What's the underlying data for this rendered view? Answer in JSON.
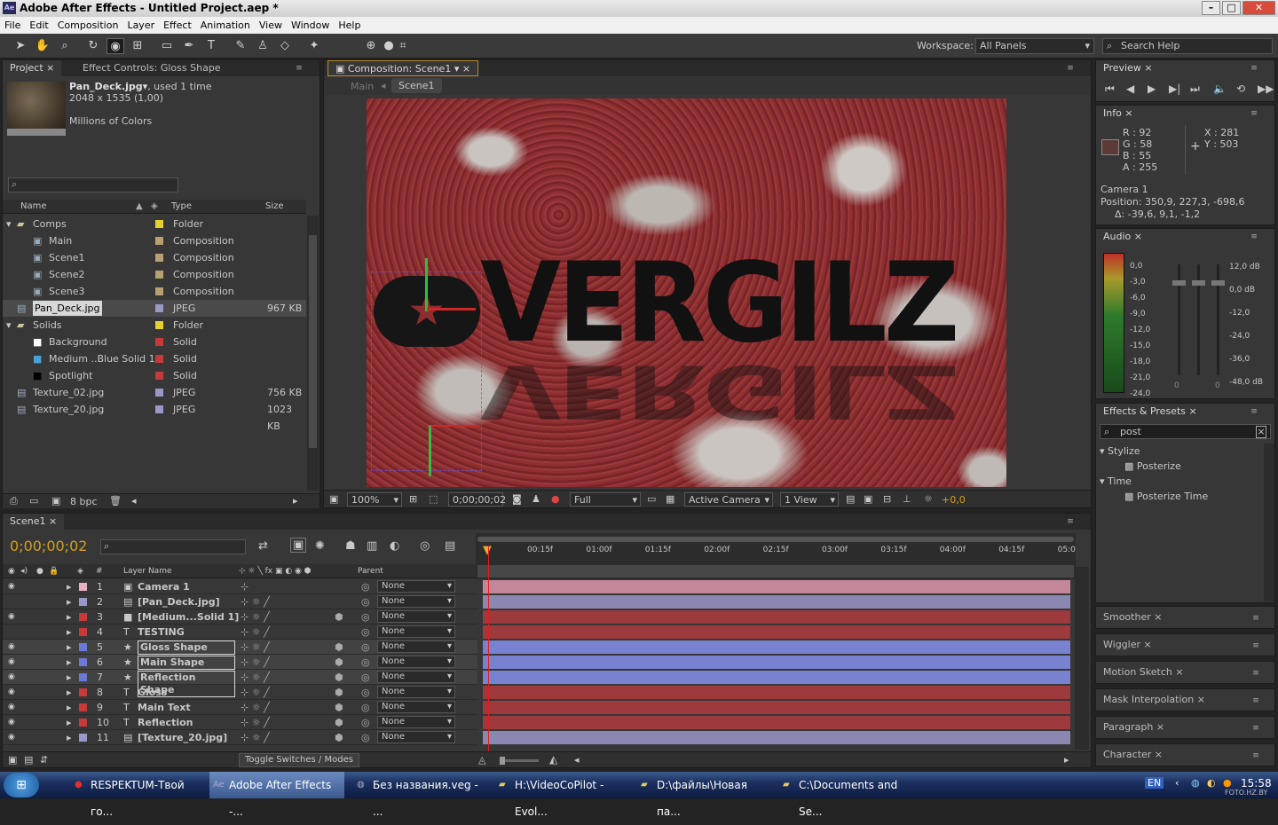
{
  "app": {
    "title": "Adobe After Effects - Untitled Project.aep *",
    "icon": "Ae"
  },
  "menu": [
    "File",
    "Edit",
    "Composition",
    "Layer",
    "Effect",
    "Animation",
    "View",
    "Window",
    "Help"
  ],
  "workspace": {
    "label": "Workspace:",
    "value": "All Panels"
  },
  "search_help": "Search Help",
  "project": {
    "tab": "Project",
    "effect_tab": "Effect Controls: Gloss Shape",
    "file": "Pan_Deck.jpg",
    "used": ", used 1 time",
    "dims": "2048 x 1535 (1,00)",
    "colors": "Millions of Colors",
    "cols": {
      "name": "Name",
      "type": "Type",
      "size": "Size"
    },
    "items": [
      {
        "name": "Comps",
        "type": "Folder",
        "size": "",
        "color": "#e6d030"
      },
      {
        "name": "Main",
        "type": "Composition",
        "size": "",
        "color": "#b8a070"
      },
      {
        "name": "Scene1",
        "type": "Composition",
        "size": "",
        "color": "#b8a070"
      },
      {
        "name": "Scene2",
        "type": "Composition",
        "size": "",
        "color": "#b8a070"
      },
      {
        "name": "Scene3",
        "type": "Composition",
        "size": "",
        "color": "#b8a070"
      },
      {
        "name": "Pan_Deck.jpg",
        "type": "JPEG",
        "size": "967 KB",
        "color": "#9a98c8"
      },
      {
        "name": "Solids",
        "type": "Folder",
        "size": "",
        "color": "#e6d030"
      },
      {
        "name": "Background",
        "type": "Solid",
        "size": "",
        "color": "#c83a3a"
      },
      {
        "name": "Medium ..Blue Solid 1",
        "type": "Solid",
        "size": "",
        "color": "#c83a3a"
      },
      {
        "name": "Spotlight",
        "type": "Solid",
        "size": "",
        "color": "#c83a3a"
      },
      {
        "name": "Texture_02.jpg",
        "type": "JPEG",
        "size": "756 KB",
        "color": "#9a98c8"
      },
      {
        "name": "Texture_20.jpg",
        "type": "JPEG",
        "size": "1023 KB",
        "color": "#9a98c8"
      }
    ],
    "bpc": "8 bpc"
  },
  "composition": {
    "tab": "Composition: Scene1",
    "crumbs": [
      "Main",
      "Scene1"
    ],
    "zoom": "100%",
    "timecode": "0;00;00;02",
    "res": "Full",
    "camera": "Active Camera",
    "view": "1 View",
    "exposure": "+0,0",
    "logo_text": "VERGILZ"
  },
  "preview": {
    "tab": "Preview"
  },
  "info": {
    "tab": "Info",
    "r": "R : 92",
    "g": "G : 58",
    "b": "B : 55",
    "a": "A : 255",
    "x": "X : 281",
    "y": "Y : 503",
    "cam": "Camera 1",
    "pos": "Position: 350,9, 227,3, -698,6",
    "delta": "Δ: -39,6, 9,1, -1,2",
    "swatch": "#5c3a37"
  },
  "audio": {
    "tab": "Audio",
    "left": [
      "0,0",
      "-3,0",
      "-6,0",
      "-9,0",
      "-12,0",
      "-15,0",
      "-18,0",
      "-21,0",
      "-24,0"
    ],
    "right": [
      "12,0 dB",
      "0,0 dB",
      "-12,0",
      "-24,0",
      "-36,0",
      "-48,0 dB"
    ],
    "zero1": "0",
    "zero2": "0"
  },
  "effects": {
    "tab": "Effects & Presets",
    "search": "post",
    "groups": [
      {
        "name": "Stylize",
        "items": [
          "Posterize"
        ]
      },
      {
        "name": "Time",
        "items": [
          "Posterize Time"
        ]
      }
    ]
  },
  "collapsed_panels": [
    "Smoother",
    "Wiggler",
    "Motion Sketch",
    "Mask Interpolation",
    "Paragraph",
    "Character"
  ],
  "timeline": {
    "tab": "Scene1",
    "timecode": "0;00;00;02",
    "layer_header": "Layer Name",
    "parent_header": "Parent",
    "num_header": "#",
    "ruler": [
      "00:15f",
      "01:00f",
      "01:15f",
      "02:00f",
      "02:15f",
      "03:00f",
      "03:15f",
      "04:00f",
      "04:15f",
      "05:0"
    ],
    "toggle": "Toggle Switches / Modes",
    "layers": [
      {
        "n": "1",
        "name": "Camera 1",
        "icon": "▣",
        "color": "#e8b0c0",
        "bar": "#c4879a",
        "parent": "None"
      },
      {
        "n": "2",
        "name": "[Pan_Deck.jpg]",
        "icon": "▤",
        "color": "#9a98c8",
        "bar": "#8a88b0",
        "parent": "None"
      },
      {
        "n": "3",
        "name": "[Medium...Solid 1]",
        "icon": "■",
        "color": "#c83a3a",
        "bar": "#9c3a3e",
        "parent": "None"
      },
      {
        "n": "4",
        "name": "TESTING",
        "icon": "T",
        "color": "#c83a3a",
        "bar": "#9c3a3e",
        "parent": "None"
      },
      {
        "n": "5",
        "name": "Gloss Shape",
        "icon": "★",
        "color": "#6a78d8",
        "bar": "#7882d0",
        "parent": "None"
      },
      {
        "n": "6",
        "name": "Main Shape",
        "icon": "★",
        "color": "#6a78d8",
        "bar": "#7882d0",
        "parent": "None"
      },
      {
        "n": "7",
        "name": "Reflection Shape",
        "icon": "★",
        "color": "#6a78d8",
        "bar": "#7882d0",
        "parent": "None"
      },
      {
        "n": "8",
        "name": "Gloss",
        "icon": "T",
        "color": "#c83a3a",
        "bar": "#9c3a3e",
        "parent": "None"
      },
      {
        "n": "9",
        "name": "Main Text",
        "icon": "T",
        "color": "#c83a3a",
        "bar": "#9c3a3e",
        "parent": "None"
      },
      {
        "n": "10",
        "name": "Reflection",
        "icon": "T",
        "color": "#c83a3a",
        "bar": "#9c3a3e",
        "parent": "None"
      },
      {
        "n": "11",
        "name": "[Texture_20.jpg]",
        "icon": "▤",
        "color": "#9a98c8",
        "bar": "#8a88b0",
        "parent": "None"
      }
    ]
  },
  "taskbar": {
    "items": [
      "RESPEKTUM-Твой го...",
      "Adobe After Effects -...",
      "Без названия.veg - ...",
      "H:\\VideoCoPilot - Evol...",
      "D:\\файлы\\Новая па...",
      "C:\\Documents and Se..."
    ],
    "lang": "EN",
    "clock": "15:58",
    "watermark": "FOTO.HZ.BY"
  }
}
